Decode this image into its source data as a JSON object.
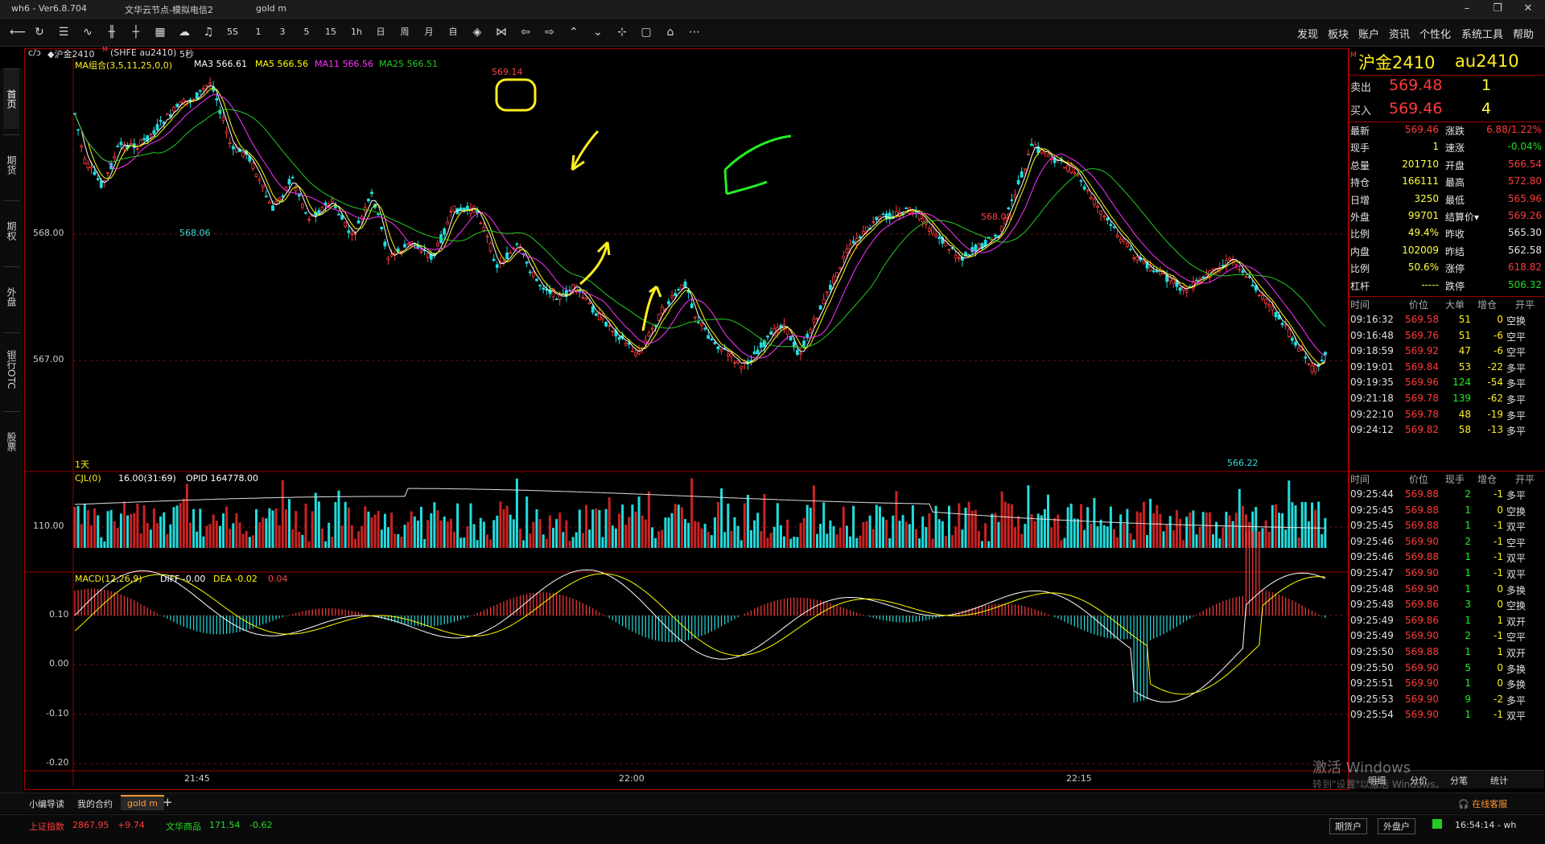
{
  "titlebar": {
    "app_version": "wh6 - Ver6.8.704",
    "server": "文华云节点-模拟电信2",
    "account": "gold m"
  },
  "toolbar": {
    "period_labels": [
      "5S",
      "1",
      "3",
      "5",
      "15",
      "1h",
      "日",
      "周",
      "月",
      "自"
    ],
    "menus": [
      "发现",
      "板块",
      "账户",
      "资讯",
      "个性化",
      "系统工具",
      "帮助"
    ]
  },
  "left_tabs": [
    "首页",
    "期货",
    "期权",
    "外盘",
    "银行OTC",
    "股票"
  ],
  "chart": {
    "header": {
      "nav": "c/ɔ",
      "symbol": "◆沪金2410",
      "superscript": "M",
      "symbol_code": "(SHFE au2410)",
      "interval": "5秒"
    },
    "ma_legend": {
      "label": "MA组合(3,5,11,25,0,0)",
      "ma3": "MA3 566.61",
      "ma5": "MA5 566.56",
      "ma11": "MA11 566.56",
      "ma25": "MA25 566.51"
    },
    "price_labels": [
      "568.00",
      "567.00"
    ],
    "annotations": {
      "high": "569.14",
      "low_left": "568.06",
      "mid_high": "568.08",
      "low_right": "566.22",
      "period": "1天"
    },
    "volume_legend": {
      "label": "CJL(0)",
      "value": "16.00(31:69)",
      "opid": "OPID 164778.00",
      "axis": "110.00"
    },
    "macd_legend": {
      "label": "MACD(12,26,9)",
      "diff": "DIFF -0.00",
      "dea": "DEA -0.02",
      "macd": "0.04",
      "axis": [
        "0.10",
        "0.00",
        "-0.10",
        "-0.20"
      ]
    },
    "time_labels": [
      "21:45",
      "22:00",
      "22:15"
    ]
  },
  "quote": {
    "name": "沪金2410",
    "code": "au2410",
    "sell_label": "卖出",
    "sell_price": "569.48",
    "sell_vol": "1",
    "buy_label": "买入",
    "buy_price": "569.46",
    "buy_vol": "4",
    "stats": [
      [
        "最新",
        "569.46",
        "涨跌",
        "6.88/1.22%"
      ],
      [
        "现手",
        "1",
        "速涨",
        "-0.04%"
      ],
      [
        "总量",
        "201710",
        "开盘",
        "566.54"
      ],
      [
        "持仓",
        "166111",
        "最高",
        "572.80"
      ],
      [
        "日增",
        "3250",
        "最低",
        "565.96"
      ],
      [
        "外盘",
        "99701",
        "结算价▾",
        "569.26"
      ],
      [
        "比例",
        "49.4%",
        "昨收",
        "565.30"
      ],
      [
        "内盘",
        "102009",
        "昨结",
        "562.58"
      ],
      [
        "比例",
        "50.6%",
        "涨停",
        "618.82"
      ],
      [
        "杠杆",
        "-----",
        "跌停",
        "506.32"
      ]
    ],
    "bigorder_headers": [
      "时间",
      "价位",
      "大单",
      "增仓",
      "开平"
    ],
    "bigorders": [
      [
        "09:16:32",
        "569.58",
        "51",
        "0",
        "空换"
      ],
      [
        "09:16:48",
        "569.76",
        "51",
        "-6",
        "空平"
      ],
      [
        "09:18:59",
        "569.92",
        "47",
        "-6",
        "空平"
      ],
      [
        "09:19:01",
        "569.84",
        "53",
        "-22",
        "多平"
      ],
      [
        "09:19:35",
        "569.96",
        "124",
        "-54",
        "多平"
      ],
      [
        "09:21:18",
        "569.78",
        "139",
        "-62",
        "多平"
      ],
      [
        "09:22:10",
        "569.78",
        "48",
        "-19",
        "多平"
      ],
      [
        "09:24:12",
        "569.82",
        "58",
        "-13",
        "多平"
      ]
    ],
    "tick_headers": [
      "时间",
      "价位",
      "现手",
      "增仓",
      "开平"
    ],
    "ticks": [
      [
        "09:25:44",
        "569.88",
        "2",
        "-1",
        "多平"
      ],
      [
        "09:25:45",
        "569.88",
        "1",
        "0",
        "空换"
      ],
      [
        "09:25:45",
        "569.88",
        "1",
        "-1",
        "双平"
      ],
      [
        "09:25:46",
        "569.90",
        "2",
        "-1",
        "空平"
      ],
      [
        "09:25:46",
        "569.88",
        "1",
        "-1",
        "双平"
      ],
      [
        "09:25:47",
        "569.90",
        "1",
        "-1",
        "双平"
      ],
      [
        "09:25:48",
        "569.90",
        "1",
        "0",
        "多换"
      ],
      [
        "09:25:48",
        "569.86",
        "3",
        "0",
        "空换"
      ],
      [
        "09:25:49",
        "569.86",
        "1",
        "1",
        "双开"
      ],
      [
        "09:25:49",
        "569.90",
        "2",
        "-1",
        "空平"
      ],
      [
        "09:25:50",
        "569.88",
        "1",
        "1",
        "双开"
      ],
      [
        "09:25:50",
        "569.90",
        "5",
        "0",
        "多换"
      ],
      [
        "09:25:51",
        "569.90",
        "1",
        "0",
        "多换"
      ],
      [
        "09:25:53",
        "569.90",
        "9",
        "-2",
        "多平"
      ],
      [
        "09:25:54",
        "569.90",
        "1",
        "-1",
        "双平"
      ]
    ],
    "bottom_tabs": [
      "明细",
      "分价",
      "分笔",
      "统计"
    ]
  },
  "watermark": {
    "line1": "激活 Windows",
    "line2": "转到\"设置\"以激活 Windows。"
  },
  "bottom_tabs": [
    "小编导读",
    "我的合约",
    "gold m",
    "+"
  ],
  "status": {
    "index_name": "上证指数",
    "index_value": "2867.95",
    "index_change": "+9.74",
    "commodity_name": "文华商品",
    "commodity_value": "171.54",
    "commodity_change": "-0.62",
    "online_service": "在线客服",
    "futures_account": "期货户",
    "foreign_account": "外盘户",
    "clock": "16:54:14 - wh"
  },
  "colors": {
    "up": "#ff3b3b",
    "down": "#22dddd",
    "frame": "#a00000",
    "ma3": "#ffffff",
    "ma5": "#ffff00",
    "ma11": "#ff33ff",
    "ma25": "#22cc22",
    "annotation_yellow": "#ffee22",
    "annotation_green": "#22ee22"
  }
}
